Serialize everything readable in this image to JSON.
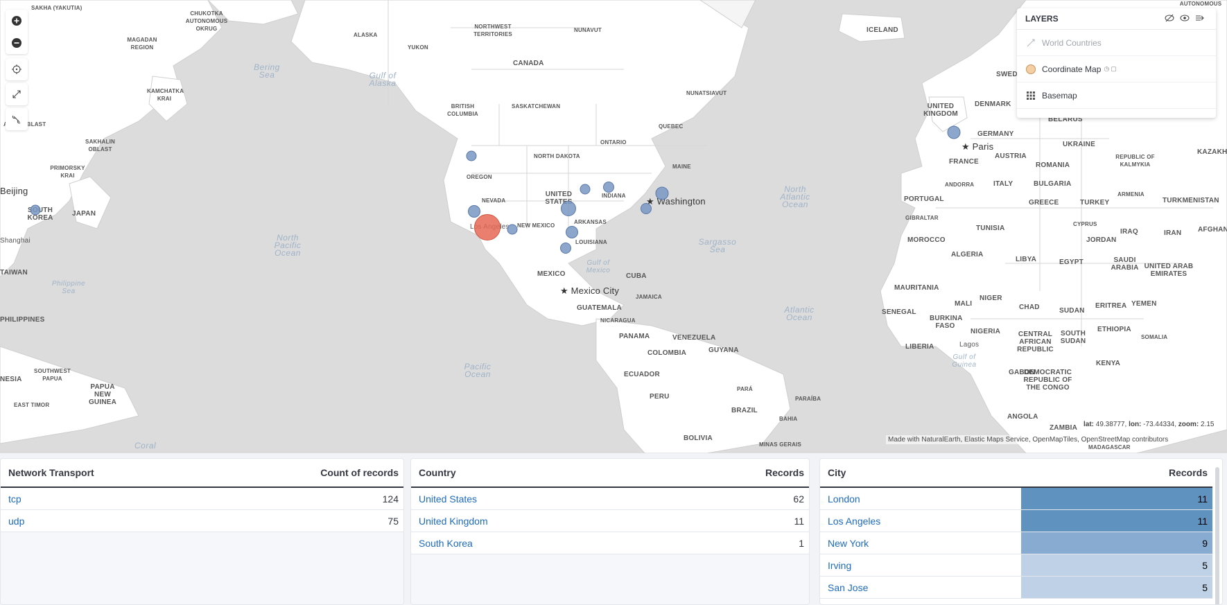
{
  "map": {
    "labels": {
      "sakha": "SAKHA (YAKUTIA)",
      "chukotka": "CHUKOTKA AUTONOMOUS OKRUG",
      "magadan": "MAGADAN REGION",
      "alaska": "ALASKA",
      "yukon": "YUKON",
      "northwest": "NORTHWEST TERRITORIES",
      "nunavut": "NUNAVUT",
      "canada": "CANADA",
      "iceland": "ICELAND",
      "kamchatka": "KAMCHATKA KRAI",
      "nunatsiavut": "NUNATSIAVUT",
      "bering": "Bering Sea",
      "gulfalaska": "Gulf of Alaska",
      "amur": "AMUR OBLAST",
      "sakhalin": "SAKHALIN OBLAST",
      "primorsky": "PRIMORSKY KRAI",
      "bc": "BRITISH COLUMBIA",
      "saskatchewan": "SASKATCHEWAN",
      "ontario": "ONTARIO",
      "quebec": "QUEBEC",
      "uk": "UNITED KINGDOM",
      "denmark": "DENMARK",
      "swed": "SWED",
      "belarus": "BELARUS",
      "germany": "GERMANY",
      "paris": "Paris",
      "ukraine": "UKRAINE",
      "france": "FRANCE",
      "austria": "AUSTRIA",
      "kalmykia": "REPUBLIC OF KALMYKIA",
      "kazakh": "KAZAKH",
      "romania": "ROMANIA",
      "northdakota": "NORTH DAKOTA",
      "oregon": "OREGON",
      "maine": "MAINE",
      "beijing": "Beijing",
      "southkorea": "SOUTH KOREA",
      "japan": "JAPAN",
      "nevada": "NEVADA",
      "us": "UNITED STATES",
      "indiana": "INDIANA",
      "washington": "Washington",
      "andorra": "ANDORRA",
      "italy": "ITALY",
      "bulgaria": "BULGARIA",
      "armenia": "ARMENIA",
      "northatlantic": "North Atlantic Ocean",
      "portugal": "PORTUGAL",
      "greece": "GREECE",
      "turkey": "TURKEY",
      "turkmenistan": "TURKMENISTAN",
      "losangeles": "Los Angeles",
      "newmexico": "NEW MEXICO",
      "arkansas": "ARKANSAS",
      "gibraltar": "GIBRALTAR",
      "cyprus": "CYPRUS",
      "afghan": "AFGHANIS",
      "shanghai": "Shanghai",
      "northpacific": "North Pacific Ocean",
      "tunisia": "TUNISIA",
      "iraq": "IRAQ",
      "iran": "IRAN",
      "louisiana": "LOUISIANA",
      "sargasso": "Sargasso Sea",
      "morocco": "MOROCCO",
      "jordan": "JORDAN",
      "algeria": "ALGERIA",
      "libya": "LIBYA",
      "egypt": "EGYPT",
      "saudi": "SAUDI ARABIA",
      "uae": "UNITED ARAB EMIRATES",
      "taiwan": "TAIWAN",
      "mexico": "MEXICO",
      "gulfmexico": "Gulf of Mexico",
      "cuba": "CUBA",
      "philippinesea": "Philippine Sea",
      "mexicocity": "Mexico City",
      "jamaica": "JAMAICA",
      "mauritania": "MAURITANIA",
      "mali": "MALI",
      "niger": "NIGER",
      "chad": "CHAD",
      "sudan": "SUDAN",
      "eritrea": "ERITREA",
      "yemen": "YEMEN",
      "guatemala": "GUATEMALA",
      "nicaragua": "NICARAGUA",
      "atlantic": "Atlantic Ocean",
      "senegal": "SENEGAL",
      "burkina": "BURKINA FASO",
      "philippines": "PHILIPPINES",
      "panama": "PANAMA",
      "venezuela": "VENEZUELA",
      "nigeria": "NIGERIA",
      "car": "CENTRAL AFRICAN REPUBLIC",
      "southsudan": "SOUTH SUDAN",
      "ethiopia": "ETHIOPIA",
      "somalia": "SOMALIA",
      "colombia": "COLOMBIA",
      "guyana": "GUYANA",
      "liberia": "LIBERIA",
      "lagos": "Lagos",
      "gulfguinea": "Gulf of Guinea",
      "pacific": "Pacific Ocean",
      "kenya": "KENYA",
      "swpapua": "SOUTHWEST PAPUA",
      "ecuador": "ECUADOR",
      "gabon": "GABON",
      "drc": "DEMOCRATIC REPUBLIC OF THE CONGO",
      "nesia": "NESIA",
      "png": "PAPUA NEW GUINEA",
      "para": "PARÁ",
      "paraiba": "PARAÍBA",
      "easttimor": "EAST TIMOR",
      "peru": "PERU",
      "brazil": "BRAZIL",
      "bahia": "BAHIA",
      "angola": "ANGOLA",
      "zambia": "ZAMBIA",
      "bolivia": "BOLIVIA",
      "minas": "MINAS GERAIS",
      "coral": "Coral",
      "madagascar": "MADAGASCAR",
      "autonomous": "AUTONOMOUS DISTRICT"
    },
    "tools": {
      "zoom_in": "zoom-in-icon",
      "zoom_out": "zoom-out-icon",
      "locate": "crosshair-icon",
      "fullscreen": "expand-icon",
      "tools": "wrench-icon"
    },
    "layers": {
      "title": "LAYERS",
      "items": [
        {
          "label": "World Countries",
          "icon": "line-icon",
          "dim": true
        },
        {
          "label": "Coordinate Map",
          "icon": "circle-swatch",
          "dim": false
        },
        {
          "label": "Basemap",
          "icon": "grid-icon",
          "dim": false
        }
      ]
    },
    "attribution": "Made with NaturalEarth, Elastic Maps Service, OpenMapTiles, OpenStreetMap contributors",
    "coords": {
      "lat_label": "lat:",
      "lat": "49.38777",
      "lon_label": "lon:",
      "lon": "-73.44334",
      "zoom_label": "zoom:",
      "zoom": "2.15"
    },
    "colors": {
      "marker": "#7896c3",
      "marker_highlight": "#e76856",
      "land": "#ffffff",
      "water": "#dcdcdc"
    }
  },
  "tables": {
    "transport": {
      "headers": [
        "Network Transport",
        "Count of records"
      ],
      "rows": [
        [
          "tcp",
          "124"
        ],
        [
          "udp",
          "75"
        ]
      ]
    },
    "country": {
      "headers": [
        "Country",
        "Records"
      ],
      "rows": [
        [
          "United States",
          "62"
        ],
        [
          "United Kingdom",
          "11"
        ],
        [
          "South Korea",
          "1"
        ]
      ]
    },
    "city": {
      "headers": [
        "City",
        "Records"
      ],
      "rows": [
        [
          "London",
          "11"
        ],
        [
          "Los Angeles",
          "11"
        ],
        [
          "New York",
          "9"
        ],
        [
          "Irving",
          "5"
        ],
        [
          "San Jose",
          "5"
        ]
      ]
    }
  }
}
